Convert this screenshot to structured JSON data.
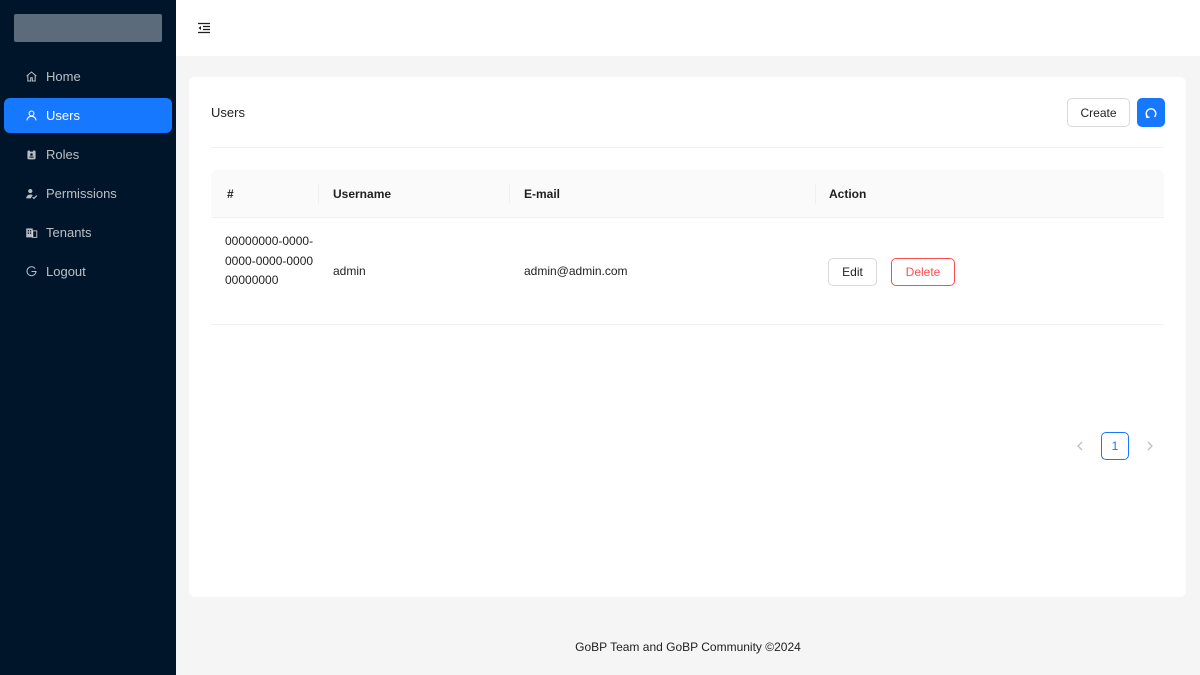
{
  "sidebar": {
    "items": [
      {
        "label": "Home",
        "icon": "home-icon"
      },
      {
        "label": "Users",
        "icon": "user-icon",
        "active": true
      },
      {
        "label": "Roles",
        "icon": "role-icon"
      },
      {
        "label": "Permissions",
        "icon": "permission-icon"
      },
      {
        "label": "Tenants",
        "icon": "tenant-icon"
      },
      {
        "label": "Logout",
        "icon": "logout-icon"
      }
    ]
  },
  "header": {
    "collapse_icon": "menu-fold-icon"
  },
  "page": {
    "title": "Users",
    "create_label": "Create",
    "refresh_icon": "reload-icon"
  },
  "table": {
    "columns": [
      "#",
      "Username",
      "E-mail",
      "Action"
    ],
    "rows": [
      {
        "id": "00000000-0000-0000-0000-000000000000",
        "username": "admin",
        "email": "admin@admin.com",
        "edit_label": "Edit",
        "delete_label": "Delete"
      }
    ]
  },
  "pagination": {
    "current_page": "1",
    "prev_icon": "chevron-left-icon",
    "next_icon": "chevron-right-icon"
  },
  "footer": {
    "text": "GoBP Team and GoBP Community ©2024"
  },
  "colors": {
    "sidebar_bg": "#001529",
    "accent": "#1677ff",
    "danger": "#ff4d4f"
  }
}
